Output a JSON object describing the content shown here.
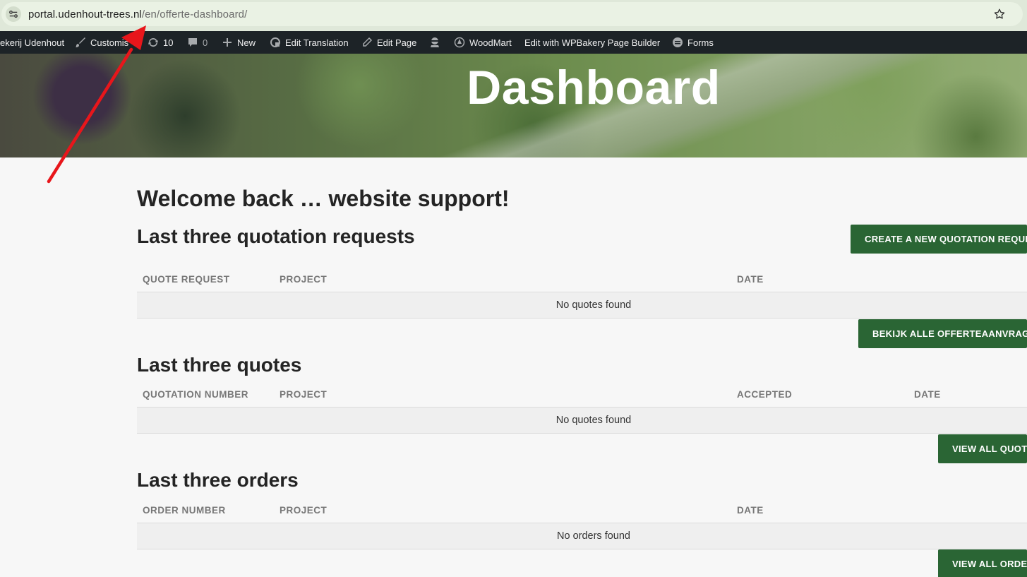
{
  "browser": {
    "url_host": "portal.udenhout-trees.nl",
    "url_path": "/en/offerte-dashboard/"
  },
  "admin_bar": {
    "site_name": "ekerij Udenhout",
    "customize": "Customis",
    "updates_count": "10",
    "comments_count": "0",
    "new": "New",
    "edit_translation": "Edit Translation",
    "edit_page": "Edit Page",
    "woodmart": "WoodMart",
    "wpbakery": "Edit with WPBakery Page Builder",
    "forms": "Forms"
  },
  "hero": {
    "title": "Dashboard"
  },
  "welcome": "Welcome back … website support!",
  "quotation_requests": {
    "title": "Last three quotation requests",
    "create_button": "CREATE A NEW QUOTATION REQUEST",
    "columns": [
      "QUOTE REQUEST",
      "PROJECT",
      "DATE"
    ],
    "empty": "No quotes found",
    "view_all_button": "BEKIJK ALLE OFFERTEAANVRAGEN"
  },
  "quotes": {
    "title": "Last three quotes",
    "columns": [
      "QUOTATION NUMBER",
      "PROJECT",
      "ACCEPTED",
      "DATE"
    ],
    "empty": "No quotes found",
    "view_all_button": "VIEW ALL QUOTES"
  },
  "orders": {
    "title": "Last three orders",
    "columns": [
      "ORDER NUMBER",
      "PROJECT",
      "DATE"
    ],
    "empty": "No orders found",
    "view_all_button": "VIEW ALL ORDERS"
  },
  "colors": {
    "button_green": "#2a6534",
    "admin_bar": "#1d2327",
    "arrow_red": "#e8161b"
  }
}
